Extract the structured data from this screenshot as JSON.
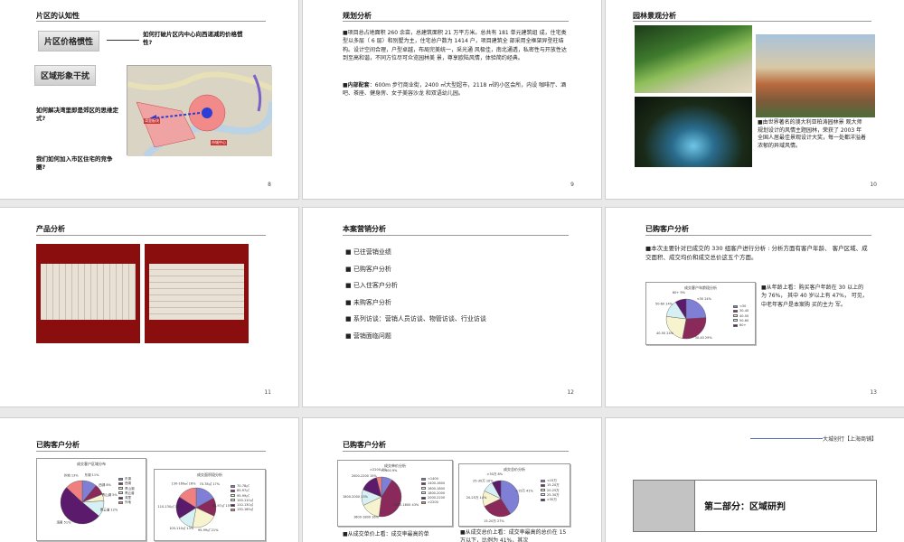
{
  "colors": {
    "slide_bg": "#ffffff",
    "accent_red": "#8b0e0e",
    "pie_blue": "#7f7fd6",
    "pie_maroon": "#8a2a5a",
    "pie_cream": "#f7f3cf",
    "pie_cyan": "#d7f0f3"
  },
  "slides": [
    {
      "title": "片区的认知性",
      "page": "8",
      "box1": "片区价格惯性",
      "box2": "区域形象干扰",
      "q1": "如何打破片区内中心向西递减的价格惯性?",
      "q2": "如何解决湾里即是郊区的思维定式?",
      "q3": "我们如何加入市区住宅的竞争圈?",
      "map_label_left": "湾里板块",
      "map_label_right": "市城中心"
    },
    {
      "title": "规划分析",
      "page": "9",
      "p1": "项目总占地面积 260 余亩，总建筑面积 21 万平方米。总共有 181 单元建筑组 成，住宅类型以多层（ 6 层）和别墅为主，住宅总户数为 1414 户，项目建筑全 部采用全框架异型柱结构。设计空间合理，户型卓越，布局完美统一，采光通 风极佳，南北通透，私密性与开放性达到至高和谐，不同方位尽可众览园林美 景，尊享欧陆风情，体验简约经典。",
      "p2_label": "内部配套",
      "p2": "：600m 步行商业街，2400 ㎡大型超市，2118 ㎡的小区会所，内设 咖啡厅、酒吧、茶座、健身房、女子美容沙龙 和双语幼儿园。"
    },
    {
      "title": "园林景观分析",
      "page": "10",
      "caption": "由世界著名的澳大利亚柏涛园林景 观大师规划设计的风情主题园林，荣获了 2003 年全国人居最佳景观设计大奖，每一处都洋溢着浓郁的异域风情。"
    },
    {
      "title": "产品分析",
      "page": "11"
    },
    {
      "title": "本案营销分析",
      "page": "12",
      "bullets": [
        "已往营销业绩",
        "已购客户分析",
        "已入住客户分析",
        "未购客户分析",
        "系列访谈：营销人员访谈、物管访谈、行业访谈",
        "营销面临问题"
      ]
    },
    {
      "title": "已购客户分析",
      "page": "13",
      "intro": "本次主要针对已成交的 330 组客户进行分析 : 分析方面有客户年龄、 客户区域、成交面积、成交均价和成交总价这五个方面。",
      "chart_title": "成交客户年龄段分析",
      "note": "从年龄上看：购买客户年龄在 30 以上的为 76%， 其中 40 岁以上有 47%， 可见，中老年客户是本案购 买的主力 军。"
    },
    {
      "title": "已购客户分析",
      "page": "14",
      "chart1_title": "成交客户区域分布",
      "chart2_title": "成交面积段分析"
    },
    {
      "title": "已购客户分析",
      "page": "15",
      "chart1_title": "成交单价分析",
      "chart2_title": "成交总价分析",
      "note": "从成交单价上看：成交率最高的单",
      "note2": "从成交总价上看：成交率最高的总价在 15 万以下，比例为 41%，其次"
    },
    {
      "header": "大城创行【上海商铺】",
      "section": "第二部分：区域研判"
    }
  ],
  "chart_data": [
    {
      "type": "pie",
      "title": "成交客户年龄段分析",
      "categories": [
        "<30",
        "30-40",
        "40-50",
        "50-60",
        "60+"
      ],
      "values": [
        24,
        29,
        24,
        14,
        9
      ]
    },
    {
      "type": "pie",
      "title": "成交客户区域分布",
      "categories": [
        "东湖",
        "西湖",
        "青山湖",
        "青云谱",
        "湾里",
        "外地"
      ],
      "values": [
        11,
        8,
        5,
        12,
        51,
        13
      ]
    },
    {
      "type": "pie",
      "title": "成交面积段分析",
      "categories": [
        "70-78㎡",
        "85-97㎡",
        "95-99㎡",
        "100-110㎡",
        "110-130㎡",
        "130-169㎡"
      ],
      "values": [
        17,
        15,
        21,
        13,
        18,
        16
      ]
    },
    {
      "type": "pie",
      "title": "成交单价分析",
      "categories": [
        "<1400",
        "1400-1600",
        "1600-1800",
        "1800-2000",
        "2000-2200",
        ">2200"
      ],
      "values": [
        9,
        43,
        16,
        13,
        15,
        4
      ]
    },
    {
      "type": "pie",
      "title": "成交总价分析",
      "categories": [
        "<15万",
        "15-20万",
        "20-25万",
        "25-30万",
        ">30万"
      ],
      "values": [
        41,
        27,
        14,
        10,
        8
      ]
    }
  ]
}
